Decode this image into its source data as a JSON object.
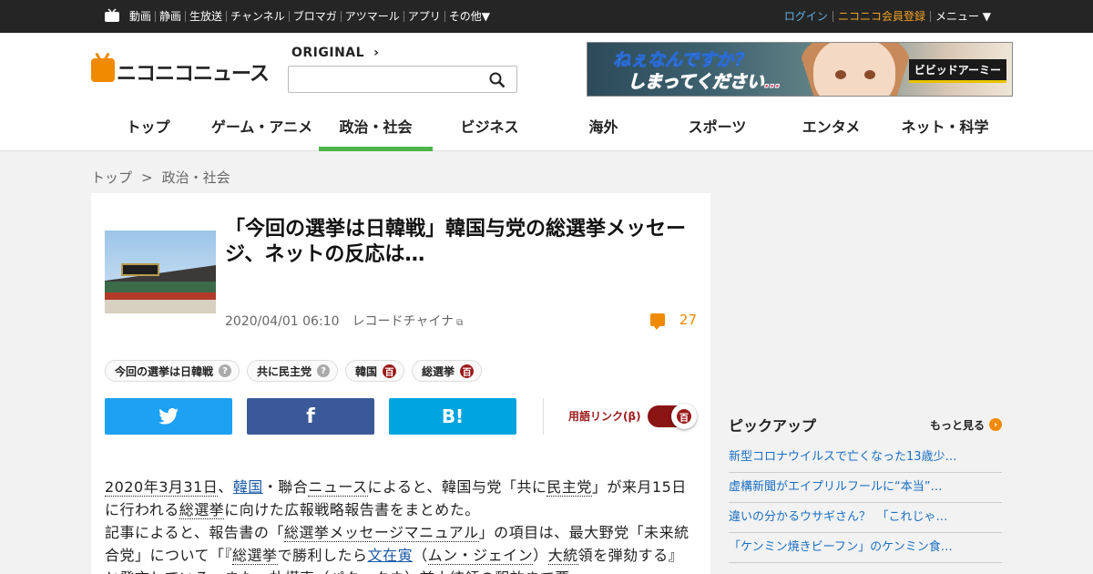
{
  "topbar": {
    "nav": [
      "動画",
      "静画",
      "生放送",
      "チャンネル",
      "ブロマガ",
      "アツマール",
      "アプリ",
      "その他▼"
    ],
    "login": "ログイン",
    "register": "ニコニコ会員登録",
    "menu": "メニュー ▼"
  },
  "header": {
    "logo_text": "ニコニコニュース",
    "original_label": "ORIGINAL",
    "search_placeholder": "",
    "banner": {
      "line1": "ねぇなんですか？",
      "line2": "しまってください…",
      "brand": "ビビッドアーミー"
    },
    "tabs": [
      {
        "label": "トップ",
        "active": false
      },
      {
        "label": "ゲーム・アニメ",
        "active": false
      },
      {
        "label": "政治・社会",
        "active": true
      },
      {
        "label": "ビジネス",
        "active": false
      },
      {
        "label": "海外",
        "active": false
      },
      {
        "label": "スポーツ",
        "active": false
      },
      {
        "label": "エンタメ",
        "active": false
      },
      {
        "label": "ネット・科学",
        "active": false
      }
    ]
  },
  "breadcrumb": {
    "home": "トップ",
    "sep": ">",
    "current": "政治・社会"
  },
  "article": {
    "title": "「今回の選挙は日韓戦」韓国与党の総選挙メッセージ、ネットの反応は…",
    "date": "2020/04/01 06:10",
    "source": "レコードチャイナ",
    "comment_count": "27",
    "tags": [
      {
        "label": "今回の選挙は日韓戦",
        "icon": "question"
      },
      {
        "label": "共に民主党",
        "icon": "question"
      },
      {
        "label": "韓国",
        "icon": "dic"
      },
      {
        "label": "総選挙",
        "icon": "dic"
      }
    ],
    "term_link_label": "用語リンク(β)",
    "dic_glyph": "百",
    "paragraphs": {
      "p1_a": "2020年3月31日",
      "p1_b": "、",
      "p1_c": "韓国",
      "p1_d": "・聯合",
      "p1_e": "ニュース",
      "p1_f": "によると、韓国与党「共に",
      "p1_g": "民主党",
      "p1_h": "」が来月15日に行われる",
      "p1_i": "総選挙",
      "p1_j": "に向けた広報戦略報告書をまとめた。",
      "p2_a": "記事によると、報告書の「",
      "p2_b": "総選挙メッセージマニュアル",
      "p2_c": "」の項目は、最大野党「未来統合党」について「『",
      "p2_d": "総選挙",
      "p2_e": "で勝利したら",
      "p2_f": "文在寅",
      "p2_g": "（",
      "p2_h": "ムン・ジェイン",
      "p2_i": "）",
      "p2_j": "大統",
      "p3": "領を弾劾する』と発言している。また、朴槿恵（パク・クネ）前大統領の釈放まで要"
    }
  },
  "sidebar": {
    "pickup_title": "ピックアップ",
    "more_label": "もっと見る",
    "items": [
      "新型コロナウイルスで亡くなった13歳少…",
      "虚構新聞がエイプリルフールに“本当”…",
      "違いの分かるウサギさん？　「これじゃ…",
      "「ケンミン焼きビーフン」のケンミン食…"
    ]
  },
  "colors": {
    "accent_green": "#4cb54a",
    "orange": "#f08a00",
    "twitter": "#1da1f2",
    "facebook": "#3b5998",
    "hatena": "#00a4de",
    "dic_red": "#9b1b1b"
  }
}
